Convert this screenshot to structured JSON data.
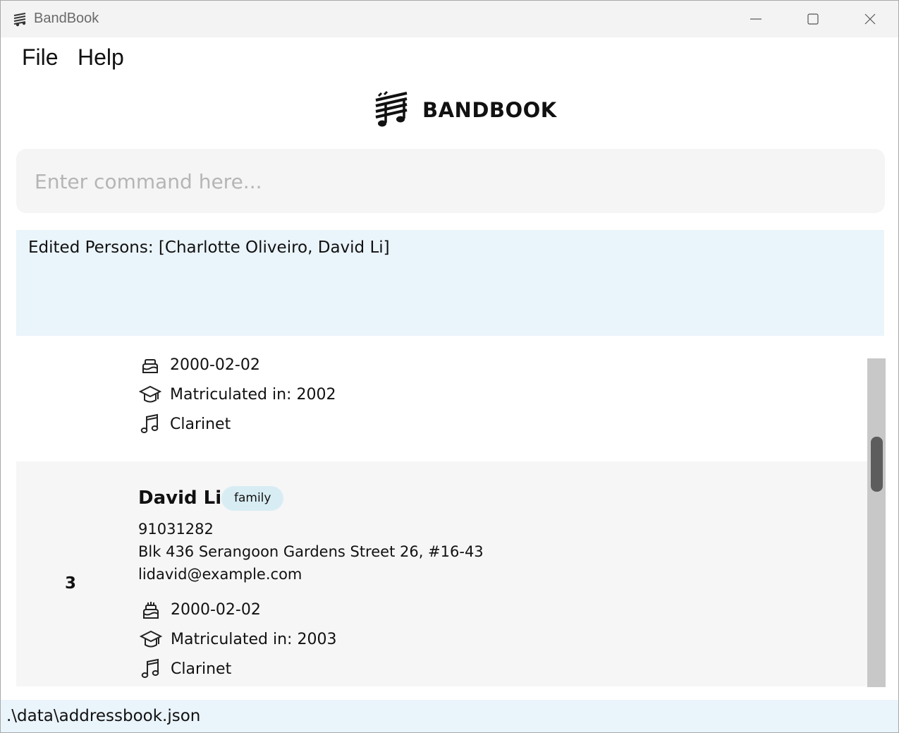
{
  "window": {
    "title": "BandBook"
  },
  "menu": {
    "file": "File",
    "help": "Help"
  },
  "logo": {
    "text": "BANDBOOK"
  },
  "command": {
    "placeholder": "Enter command here...",
    "value": ""
  },
  "result": {
    "text": "Edited Persons: [Charlotte Oliveiro, David Li]"
  },
  "list": {
    "partial_card": {
      "birthday": "2000-02-02",
      "matriculation": "Matriculated in: 2002",
      "instrument": "Clarinet"
    },
    "card": {
      "index": "3",
      "name": "David Li",
      "tag": "family",
      "phone": "91031282",
      "address": "Blk 436 Serangoon Gardens Street 26, #16-43",
      "email": "lidavid@example.com",
      "birthday": "2000-02-02",
      "matriculation": "Matriculated in: 2003",
      "instrument": "Clarinet"
    }
  },
  "status": {
    "path": ".\\data\\addressbook.json"
  },
  "icons": {
    "app": "bandbook-logo-icon",
    "minimize": "minimize-icon",
    "maximize": "maximize-icon",
    "close": "close-icon",
    "birthday": "birthday-cake-icon",
    "matriculation": "graduation-cap-icon",
    "instrument": "music-note-icon"
  },
  "colors": {
    "result_background": "#eaf4fb",
    "tag_background": "#d8edf3",
    "card_background": "#f6f6f6"
  }
}
